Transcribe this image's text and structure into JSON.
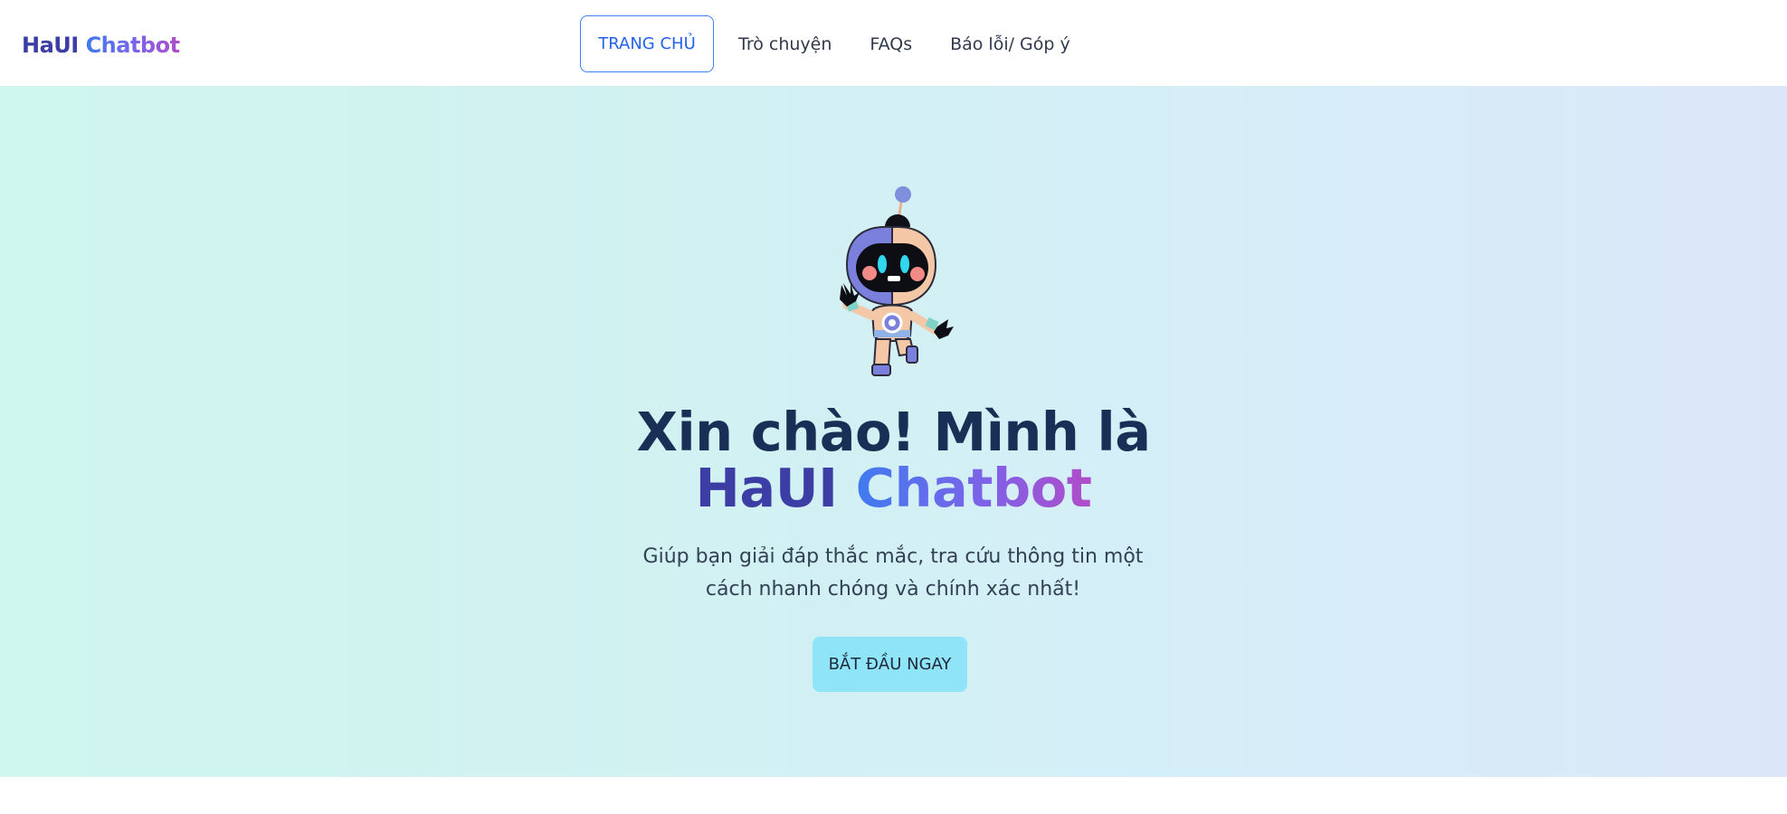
{
  "brand": {
    "part1": "HaUI",
    "part2": "Chatbot"
  },
  "nav": {
    "items": [
      {
        "label": "TRANG CHỦ",
        "active": true
      },
      {
        "label": "Trò chuyện",
        "active": false
      },
      {
        "label": "FAQs",
        "active": false
      },
      {
        "label": "Báo lỗi/ Góp ý",
        "active": false
      }
    ]
  },
  "hero": {
    "title_line1": "Xin chào! Mình là",
    "title_haui": "HaUI",
    "title_chatbot": "Chatbot",
    "subtitle": "Giúp bạn giải đáp thắc mắc, tra cứu thông tin một cách nhanh chóng và chính xác nhất!",
    "cta_label": "BẮT ĐẦU NGAY",
    "mascot": "robot-mascot-icon"
  },
  "colors": {
    "accent_blue": "#3b82f6",
    "brand_indigo": "#3c3ea6",
    "brand_purple": "#b14cc8",
    "title_navy": "#1a2f55",
    "cta_bg": "#8fe4f7",
    "hero_bg_start": "#cff6ef",
    "hero_bg_end": "#dbe7f9"
  }
}
